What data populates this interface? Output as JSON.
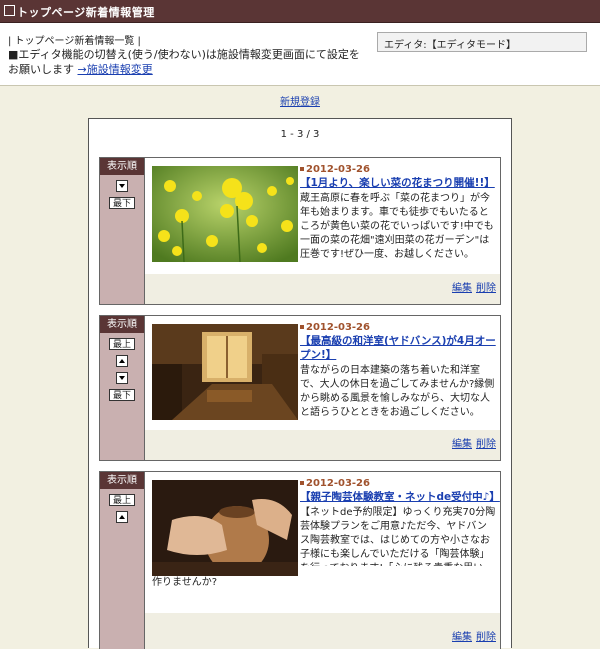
{
  "header": {
    "title": "トップページ新着情報管理"
  },
  "info": {
    "heading": "| トップページ新着情報一覧 |",
    "text": "■エディタ機能の切替え(使う/使わない)は施設情報変更画面にて設定をお願いします ",
    "link": "→施設情報変更",
    "editor_mode": "エディタ:【エディタモード】"
  },
  "new_register": "新規登録",
  "pager": "1 - 3 / 3",
  "sidebar_header": "表示順",
  "labels": {
    "top": "最上",
    "bottom": "最下",
    "edit": "編集",
    "delete": "削除"
  },
  "items": [
    {
      "date": "2012-03-26",
      "title": "【1月より、楽しい菜の花まつり開催!!】",
      "body": "蔵王高原に春を呼ぶ「菜の花まつり」が今年も始まります。車でも徒歩でもいたるところが黄色い菜の花でいっぱいです!中でも一面の菜の花畑\"遠刈田菜の花ガーデン\"は圧巻です!ぜひ一度、お越しください。",
      "photo": "canola-flowers-photo"
    },
    {
      "date": "2012-03-26",
      "title": "【最高級の和洋室(ヤドバンス)が4月オープン!】",
      "body": "昔ながらの日本建築の落ち着いた和洋室で、大人の休日を過ごしてみませんか?縁側から眺める風景を愉しみながら、大切な人と語らうひとときをお過ごしください。",
      "photo": "japanese-room-photo"
    },
    {
      "date": "2012-03-26",
      "title": "【親子陶芸体験教室・ネットde受付中♪】",
      "body": "【ネットde予約限定】ゆっくり充実70分陶芸体験プランをご用意♪ただ今、ヤドバンス陶芸教室では、はじめての方や小さなお子様にも楽しんでいただける「陶芸体験」を行っております!「心に残る貴重な思い出」を一緒に作りませんか?",
      "body_a": "【ネットde予約限定】ゆっくり充実70分陶芸体験プランをご用意♪ただ今、ヤドバンス陶芸教室では、はじめての方や小さなお子様にも楽しんでいただける「陶芸体験」を行っております!「心に残る貴重な思い出」を一緒に",
      "body_b": "作りませんか?",
      "photo": "pottery-photo"
    }
  ]
}
